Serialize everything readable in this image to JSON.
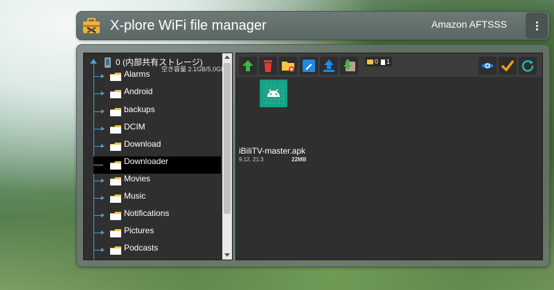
{
  "header": {
    "title": "X-plore WiFi file manager",
    "device": "Amazon AFTSSS",
    "logo_icon": "toolbox-icon",
    "menu_icon": "vertical-dots-icon"
  },
  "tree": {
    "root": {
      "label": "0 (内部共有ストレージ)",
      "free_space": "空き容量 2.1GB/5.0GB",
      "icon": "phone-icon"
    },
    "folders": [
      {
        "label": "Alarms"
      },
      {
        "label": "Android"
      },
      {
        "label": "backups"
      },
      {
        "label": "DCIM"
      },
      {
        "label": "Download"
      },
      {
        "label": "Downloader",
        "selected": true
      },
      {
        "label": "Movies"
      },
      {
        "label": "Music"
      },
      {
        "label": "Notifications"
      },
      {
        "label": "Pictures"
      },
      {
        "label": "Podcasts"
      }
    ]
  },
  "toolbar": {
    "left_buttons": [
      "go-up-arrow-icon",
      "delete-trash-icon",
      "new-folder-icon",
      "rename-pencil-icon",
      "upload-icon",
      "download-icon"
    ],
    "right_buttons": [
      "view-eye-icon",
      "select-check-icon",
      "refresh-icon"
    ],
    "counter": {
      "folders": "0",
      "files": "1"
    }
  },
  "files": [
    {
      "name": "iBiliTV-master.apk",
      "date": "9.12. 21:3",
      "size": "22MB",
      "icon": "android-apk-icon"
    }
  ],
  "colors": {
    "accent_blue": "#4b9fd6",
    "folder_yellow": "#f5c542",
    "apk_green": "#16a085"
  }
}
